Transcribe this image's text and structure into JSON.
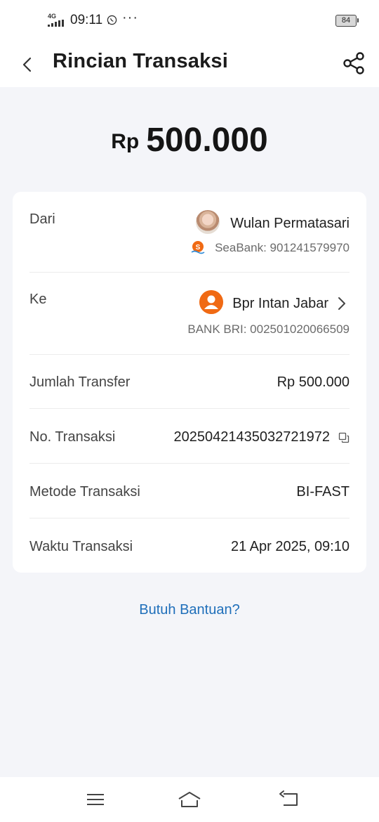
{
  "status_bar": {
    "network": "4G",
    "time": "09:11",
    "more": "···",
    "battery": "84"
  },
  "header": {
    "title": "Rincian Transaksi"
  },
  "amount": {
    "currency": "Rp",
    "value": "500.000"
  },
  "details": {
    "from": {
      "label": "Dari",
      "name": "Wulan Permatasari",
      "account": "SeaBank: 901241579970"
    },
    "to": {
      "label": "Ke",
      "name": "Bpr Intan Jabar",
      "account": "BANK BRI: 002501020066509"
    },
    "transfer_amount": {
      "label": "Jumlah Transfer",
      "value": "Rp 500.000"
    },
    "transaction_no": {
      "label": "No. Transaksi",
      "value": "20250421435032721972"
    },
    "method": {
      "label": "Metode Transaksi",
      "value": "BI-FAST"
    },
    "time": {
      "label": "Waktu Transaksi",
      "value": "21 Apr 2025, 09:10"
    }
  },
  "help": {
    "label": "Butuh Bantuan?"
  },
  "colors": {
    "accent_link": "#1f6fba",
    "seabank_orange": "#f06a14",
    "background": "#f4f5f9"
  },
  "icons": [
    "back-arrow-icon",
    "share-icon",
    "copy-icon",
    "chevron-right-icon",
    "menu-icon",
    "home-icon",
    "back-nav-icon"
  ]
}
